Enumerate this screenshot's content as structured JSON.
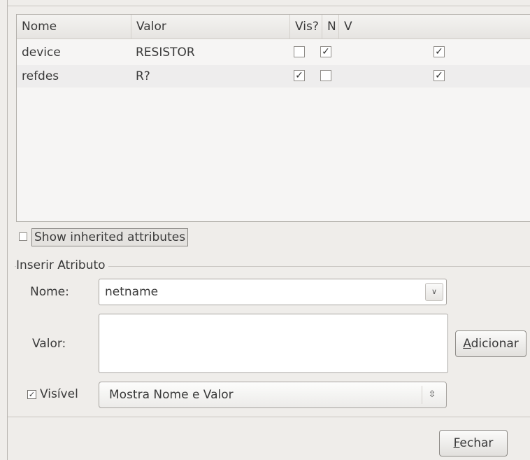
{
  "table": {
    "columns": [
      "Nome",
      "Valor",
      "Vis?",
      "N",
      "V"
    ],
    "rows": [
      {
        "name": "device",
        "value": "RESISTOR",
        "vis": false,
        "n": true,
        "v": true
      },
      {
        "name": "refdes",
        "value": "R?",
        "vis": true,
        "n": false,
        "v": true
      }
    ]
  },
  "show_inherited": {
    "label": "Show inherited attributes",
    "checked": false
  },
  "insert_group": {
    "title": "Inserir Atributo",
    "name_label": "Nome:",
    "name_value": "netname",
    "value_label": "Valor:",
    "value_text": "",
    "visible_label": "Visível",
    "visible_checked": true,
    "visibility_option": "Mostra Nome e Valor",
    "add_button": {
      "mnemonic": "A",
      "rest": "dicionar"
    }
  },
  "close_button": {
    "mnemonic": "F",
    "rest": "echar"
  }
}
